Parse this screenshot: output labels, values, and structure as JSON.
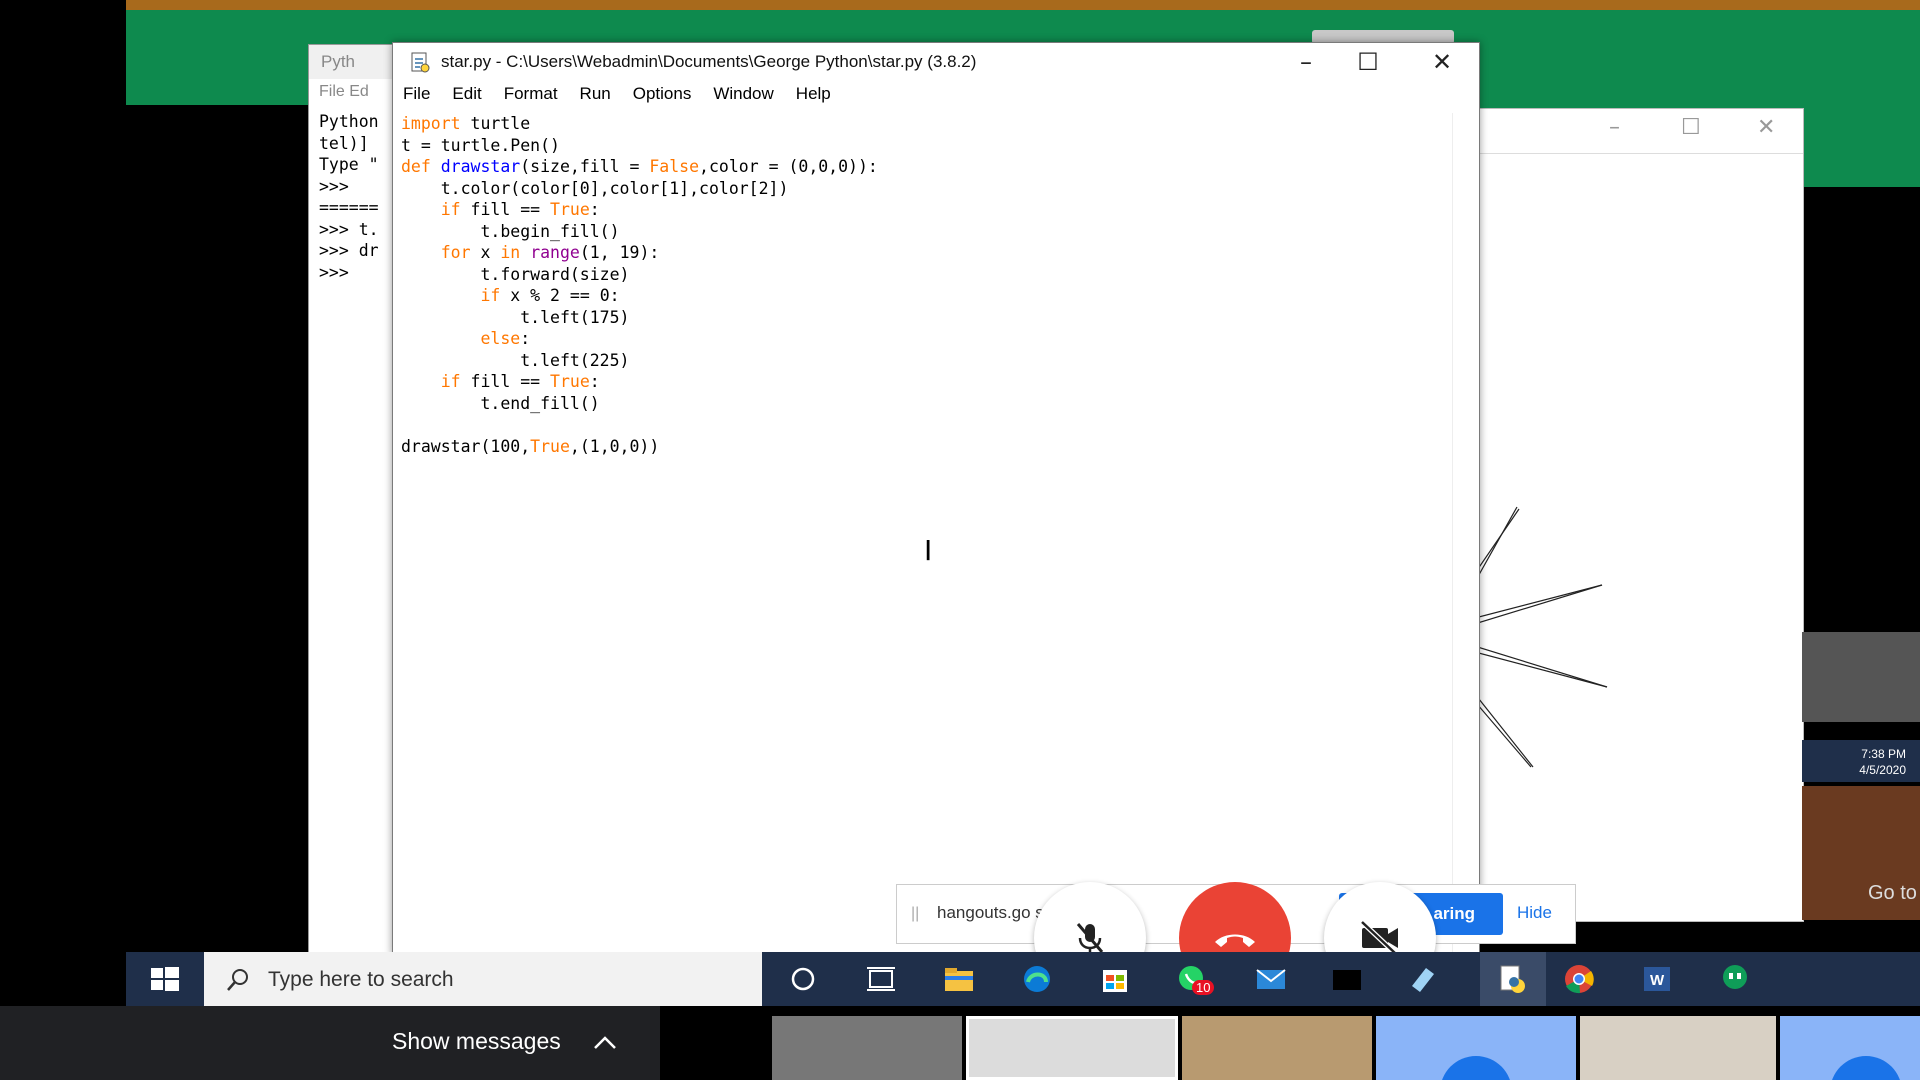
{
  "editor": {
    "title": "star.py - C:\\Users\\Webadmin\\Documents\\George Python\\star.py (3.8.2)",
    "menu": [
      "File",
      "Edit",
      "Format",
      "Run",
      "Options",
      "Window",
      "Help"
    ],
    "code_lines": [
      "import turtle",
      "t = turtle.Pen()",
      "def drawstar(size,fill = False,color = (0,0,0)):",
      "    t.color(color[0],color[1],color[2])",
      "    if fill == True:",
      "        t.begin_fill()",
      "    for x in range(1, 19):",
      "        t.forward(size)",
      "        if x % 2 == 0:",
      "            t.left(175)",
      "        else:",
      "            t.left(225)",
      "    if fill == True:",
      "        t.end_fill()",
      "",
      "drawstar(100,True,(1,0,0))"
    ]
  },
  "shell": {
    "title": "Pyth",
    "menu": "File   Ed",
    "lines": [
      "Python",
      "tel)]",
      "Type \"",
      ">>>",
      "======",
      ">>> t.",
      ">>> dr",
      ">>>"
    ]
  },
  "sharing_bar": {
    "text": "hangouts.go          s shari          een.",
    "stop_label": "aring",
    "hide_label": "Hide"
  },
  "taskbar": {
    "search_placeholder": "Type here to search",
    "whatsapp_badge": "10"
  },
  "clock": {
    "time": "7:38 PM",
    "date": "4/5/2020"
  },
  "side_thumb": {
    "goto_text": "Go to"
  },
  "meet": {
    "show_messages": "Show messages"
  },
  "colors": {
    "keyword": "#ff7700",
    "function": "#0000ff",
    "builtin": "#900090",
    "end_call": "#ea4335",
    "stop_sharing": "#1a73e8"
  }
}
